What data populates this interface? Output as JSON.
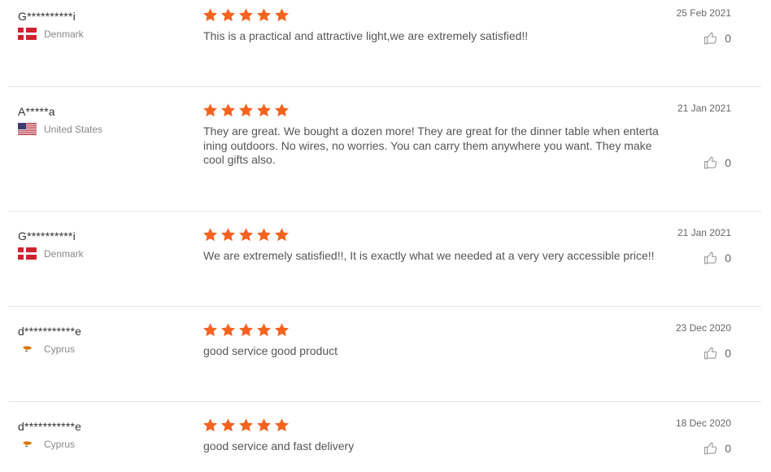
{
  "reviews": [
    {
      "user": "G**********i",
      "country": "Denmark",
      "flag": "dk",
      "rating": 5,
      "text": "This is a practical and attractive light,we are extremely satisfied!!",
      "date": "25 Feb 2021",
      "helpful": "0"
    },
    {
      "user": "A*****a",
      "country": "United States",
      "flag": "us",
      "rating": 5,
      "text": "They are great. We bought a dozen more! They are great for the dinner table when entertaining outdoors. No wires, no worries. You can carry them anywhere you want. They make cool gifts also.",
      "date": "21 Jan 2021",
      "helpful": "0"
    },
    {
      "user": "G**********i",
      "country": "Denmark",
      "flag": "dk",
      "rating": 5,
      "text": "We are extremely satisfied!!, It is exactly what we needed at a very very accessible price!!",
      "date": "21 Jan 2021",
      "helpful": "0"
    },
    {
      "user": "d***********e",
      "country": "Cyprus",
      "flag": "cy",
      "rating": 5,
      "text": "good service good product",
      "date": "23 Dec 2020",
      "helpful": "0"
    },
    {
      "user": "d***********e",
      "country": "Cyprus",
      "flag": "cy",
      "rating": 5,
      "text": "good service and fast delivery",
      "date": "18 Dec 2020",
      "helpful": "0"
    }
  ],
  "colors": {
    "star": "#f5631f",
    "divider": "#e5e5e5",
    "muted": "#888888"
  },
  "icons": {
    "star": "star-icon",
    "helpful": "thumbs-up-icon"
  }
}
